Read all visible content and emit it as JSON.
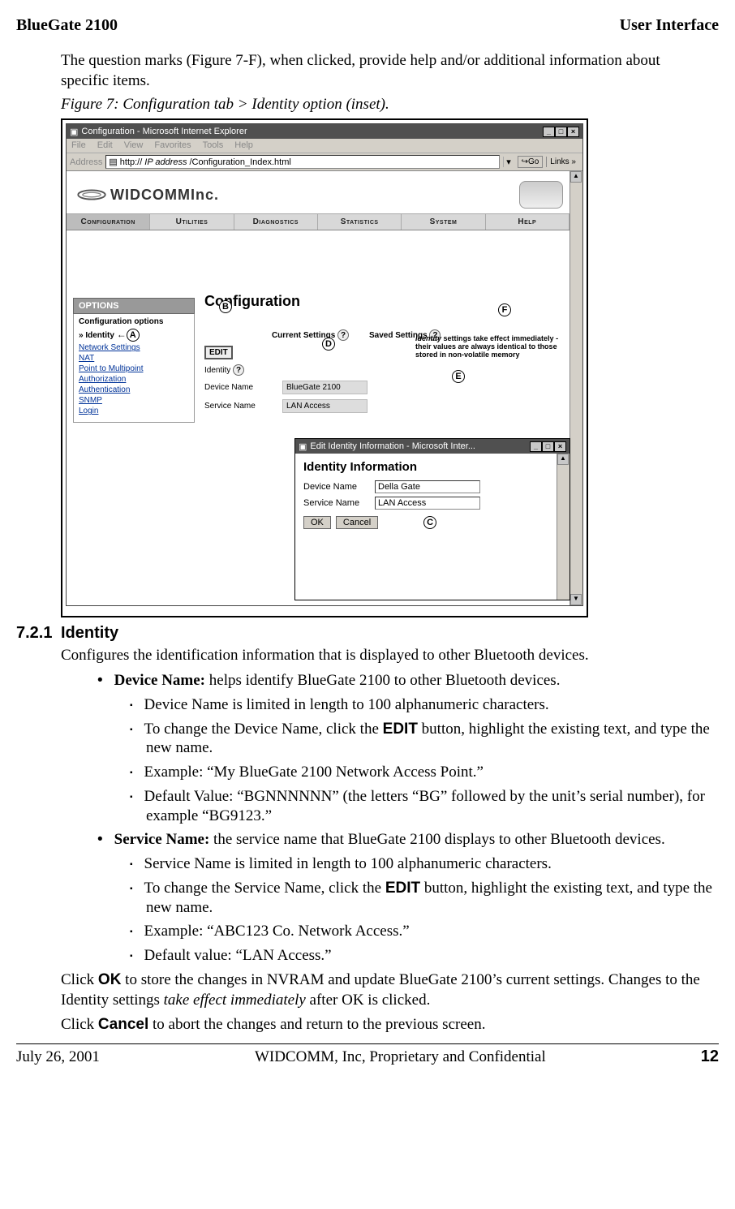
{
  "header": {
    "left": "BlueGate 2100",
    "right": "User Interface"
  },
  "intro_para": "The question marks (Figure 7-F), when clicked, provide help and/or additional information about specific items.",
  "figure_caption": "Figure 7:    Configuration tab > Identity option (inset).",
  "ie_main": {
    "title": "Configuration - Microsoft Internet Explorer",
    "menubar": [
      "File",
      "Edit",
      "View",
      "Favorites",
      "Tools",
      "Help"
    ],
    "address_label": "Address",
    "address_prefix": "http://",
    "address_ip": "IP address",
    "address_suffix": "/Configuration_Index.html",
    "go": "Go",
    "links": "Links"
  },
  "logo_text": "WIDCOMMInc.",
  "navtabs": [
    "Configuration",
    "Utilities",
    "Diagnostics",
    "Statistics",
    "System",
    "Help"
  ],
  "options": {
    "head": "OPTIONS",
    "title": "Configuration options",
    "identity": "Identity",
    "items": [
      "Network Settings",
      "NAT",
      "Point to Multipoint",
      "Authorization",
      "Authentication",
      "SNMP",
      "Login"
    ]
  },
  "main": {
    "title": "Configuration",
    "current": "Current Settings",
    "saved": "Saved Settings",
    "edit_btn": "EDIT",
    "identity_label": "Identity",
    "rows": [
      {
        "label": "Device Name",
        "value": "BlueGate 2100"
      },
      {
        "label": "Service Name",
        "value": "LAN Access"
      }
    ],
    "note_italic": "Identity",
    "note_rest": " settings take effect immediately - their values are always identical to those stored in non-volatile memory"
  },
  "popup": {
    "title": "Edit Identity Information - Microsoft Inter...",
    "heading": "Identity Information",
    "device_label": "Device Name",
    "device_value": "Della Gate",
    "service_label": "Service Name",
    "service_value": "LAN Access",
    "ok": "OK",
    "cancel": "Cancel"
  },
  "callouts": {
    "A": "A",
    "B": "B",
    "C": "C",
    "D": "D",
    "E": "E",
    "F": "F"
  },
  "section": {
    "num": "7.2.1",
    "title": "Identity",
    "intro": "Configures the identification information that is displayed to other Bluetooth devices.",
    "b1_bold": "Device Name:",
    "b1_rest": " helps identify BlueGate 2100 to other Bluetooth devices.",
    "b1_sub1": "Device Name is limited in length to 100 alphanumeric characters.",
    "b1_sub2_a": "To change the Device Name, click the ",
    "b1_sub2_btn": "EDIT",
    "b1_sub2_b": " button, highlight the existing text, and type the new name.",
    "b1_sub3": "Example: “My BlueGate 2100 Network Access Point.”",
    "b1_sub4": "Default Value: “BGNNNNNN” (the letters “BG” followed by the unit’s serial number), for example “BG9123.”",
    "b2_bold": "Service Name:",
    "b2_rest": " the service name that BlueGate 2100 displays to other Bluetooth devices.",
    "b2_sub1": "Service Name is limited in length to 100 alphanumeric characters.",
    "b2_sub2_a": "To change the Service Name, click the ",
    "b2_sub2_btn": "EDIT",
    "b2_sub2_b": " button, highlight the existing text, and type the new name.",
    "b2_sub3": "Example: “ABC123 Co. Network Access.”",
    "b2_sub4": "Default value: “LAN Access.”",
    "p_ok_a": "Click ",
    "p_ok_btn": "OK",
    "p_ok_b": " to store the changes in NVRAM and update BlueGate 2100’s current settings. Changes to the Identity settings ",
    "p_ok_i": "take effect immediately",
    "p_ok_c": " after OK is clicked.",
    "p_cancel_a": "Click ",
    "p_cancel_btn": "Cancel",
    "p_cancel_b": " to abort the changes and return to the previous screen."
  },
  "footer": {
    "date": "July 26, 2001",
    "mid": "WIDCOMM, Inc, Proprietary and Confidential",
    "page": "12"
  }
}
